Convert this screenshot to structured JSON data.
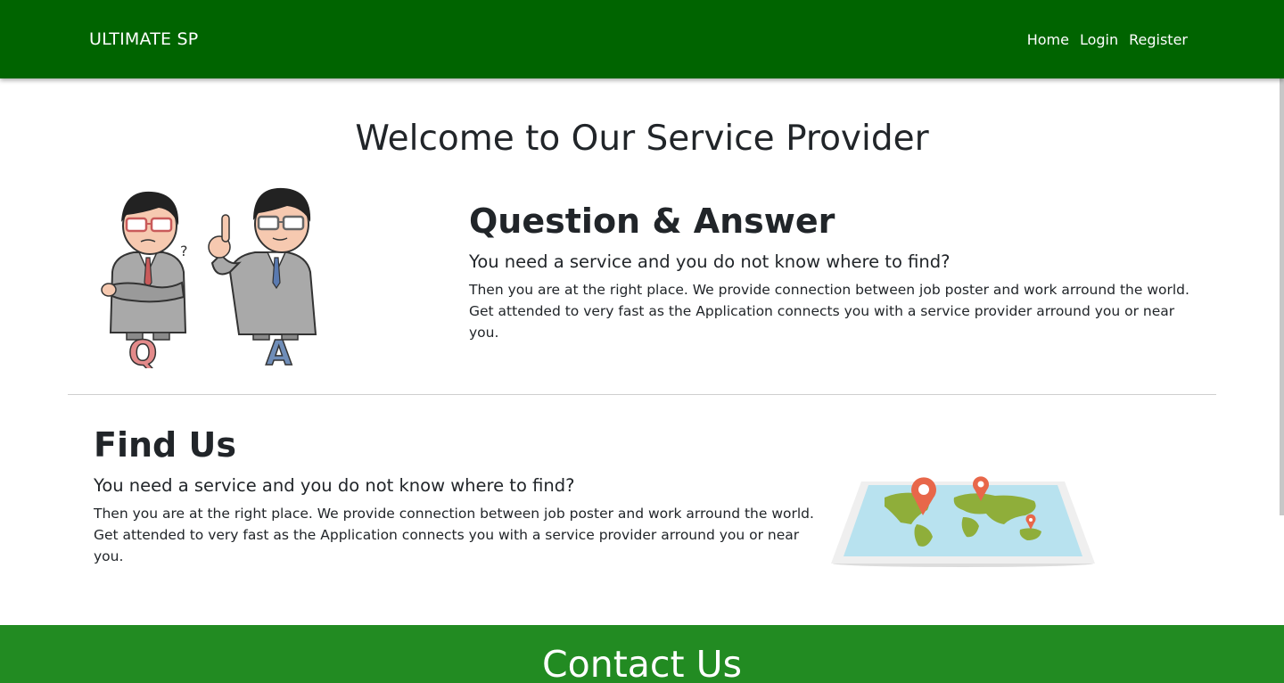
{
  "nav": {
    "brand": "ULTIMATE SP",
    "links": [
      "Home",
      "Login",
      "Register"
    ]
  },
  "main": {
    "title": "Welcome to Our Service Provider",
    "qa": {
      "title": "Question & Answer",
      "subtitle": "You need a service and you do not know where to find?",
      "body_line1": "Then you are at the right place. We provide connection between job poster and work arround the world.",
      "body_line2": "Get attended to very fast as the Application connects you with a service provider arround you or near",
      "body_line3": "you."
    },
    "find": {
      "title": "Find Us",
      "subtitle": "You need a service and you do not know where to find?",
      "body_line1": "Then you are at the right place. We provide connection between job poster and work arround the world.",
      "body_line2": "Get attended to very fast as the Application connects you with a service provider arround you or near",
      "body_line3": "you."
    }
  },
  "footer": {
    "title": "Contact Us"
  },
  "colors": {
    "navbar": "#006400",
    "footer": "#228b22",
    "map_water": "#b8e2ef",
    "map_land": "#8fae3a",
    "pin": "#e8674a"
  },
  "icons": {
    "qa_illustration": "qa-illustration-icon",
    "map_illustration": "world-map-pin-icon"
  }
}
